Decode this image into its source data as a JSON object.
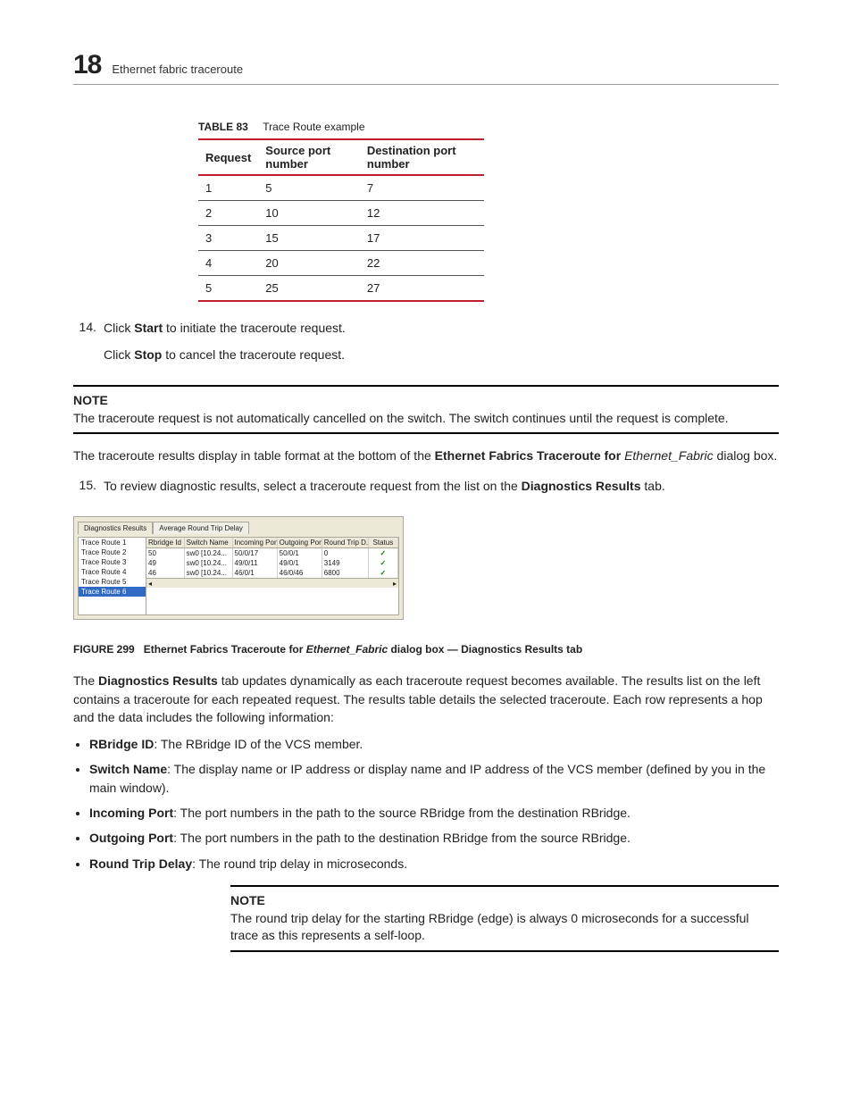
{
  "header": {
    "chapter_no": "18",
    "crumb": "Ethernet fabric traceroute"
  },
  "table83": {
    "label": "TABLE 83",
    "title": "Trace Route example",
    "headers": [
      "Request",
      "Source port number",
      "Destination port number"
    ],
    "rows": [
      [
        "1",
        "5",
        "7"
      ],
      [
        "2",
        "10",
        "12"
      ],
      [
        "3",
        "15",
        "17"
      ],
      [
        "4",
        "20",
        "22"
      ],
      [
        "5",
        "25",
        "27"
      ]
    ]
  },
  "step14": {
    "no": "14.",
    "p1a": "Click ",
    "p1b": "Start",
    "p1c": " to initiate the traceroute request.",
    "p2a": "Click ",
    "p2b": "Stop",
    "p2c": " to cancel the traceroute request."
  },
  "note1": {
    "label": "NOTE",
    "text": "The traceroute request is not automatically cancelled on the switch. The switch continues until the request is complete."
  },
  "para_results": {
    "a": "The traceroute results display in table format at the bottom of the ",
    "b": "Ethernet Fabrics Traceroute for",
    "c": "Ethernet_Fabric",
    "d": " dialog box."
  },
  "step15": {
    "no": "15.",
    "a": "To review diagnostic results, select a traceroute request from the list on the ",
    "b": "Diagnostics Results",
    "c": " tab."
  },
  "figure": {
    "tabs": {
      "t1": "Diagnostics Results",
      "t2": "Average Round Trip Delay"
    },
    "left_items": [
      "Trace Route 1",
      "Trace Route 2",
      "Trace Route 3",
      "Trace Route 4",
      "Trace Route 5",
      "Trace Route 6"
    ],
    "grid": {
      "headers": [
        "Rbridge Id",
        "Switch Name",
        "Incoming Port",
        "Outgoing Port",
        "Round Trip D...",
        "Status"
      ],
      "rows": [
        [
          "50",
          "sw0 [10.24...",
          "50/0/17",
          "50/0/1",
          "0",
          "✓"
        ],
        [
          "49",
          "sw0 [10.24...",
          "49/0/11",
          "49/0/1",
          "3149",
          "✓"
        ],
        [
          "46",
          "sw0 [10.24...",
          "46/0/1",
          "46/0/46",
          "6800",
          "✓"
        ]
      ]
    },
    "caption_label": "FIGURE 299",
    "caption_a": "Ethernet Fabrics Traceroute for ",
    "caption_it": "Ethernet_Fabric",
    "caption_b": " dialog box — Diagnostics Results tab"
  },
  "para_dyn": {
    "a": "The ",
    "b": "Diagnostics Results",
    "c": " tab updates dynamically as each traceroute request becomes available. The results list on the left contains a traceroute for each repeated request. The results table details the selected traceroute. Each row represents a hop and the data includes the following information:"
  },
  "bullets": {
    "b1l": "RBridge ID",
    "b1t": ": The RBridge ID of the VCS member.",
    "b2l": "Switch Name",
    "b2t": ": The display name or IP address or display name and IP address of the VCS member (defined by you in the main window).",
    "b3l": "Incoming Port",
    "b3t": ": The port numbers in the path to the source RBridge from the destination RBridge.",
    "b4l": "Outgoing Port",
    "b4t": ": The port numbers in the path to the destination RBridge from the source RBridge.",
    "b5l": "Round Trip Delay",
    "b5t": ": The round trip delay in microseconds."
  },
  "note2": {
    "label": "NOTE",
    "text": "The round trip delay for the starting RBridge (edge) is always 0 microseconds for a successful trace as this represents a self-loop."
  },
  "chart_data": {
    "type": "table",
    "title": "Trace Route example",
    "categories": [
      "Request",
      "Source port number",
      "Destination port number"
    ],
    "series": [
      {
        "name": "Request",
        "values": [
          1,
          2,
          3,
          4,
          5
        ]
      },
      {
        "name": "Source port number",
        "values": [
          5,
          10,
          15,
          20,
          25
        ]
      },
      {
        "name": "Destination port number",
        "values": [
          7,
          12,
          17,
          22,
          27
        ]
      }
    ]
  }
}
